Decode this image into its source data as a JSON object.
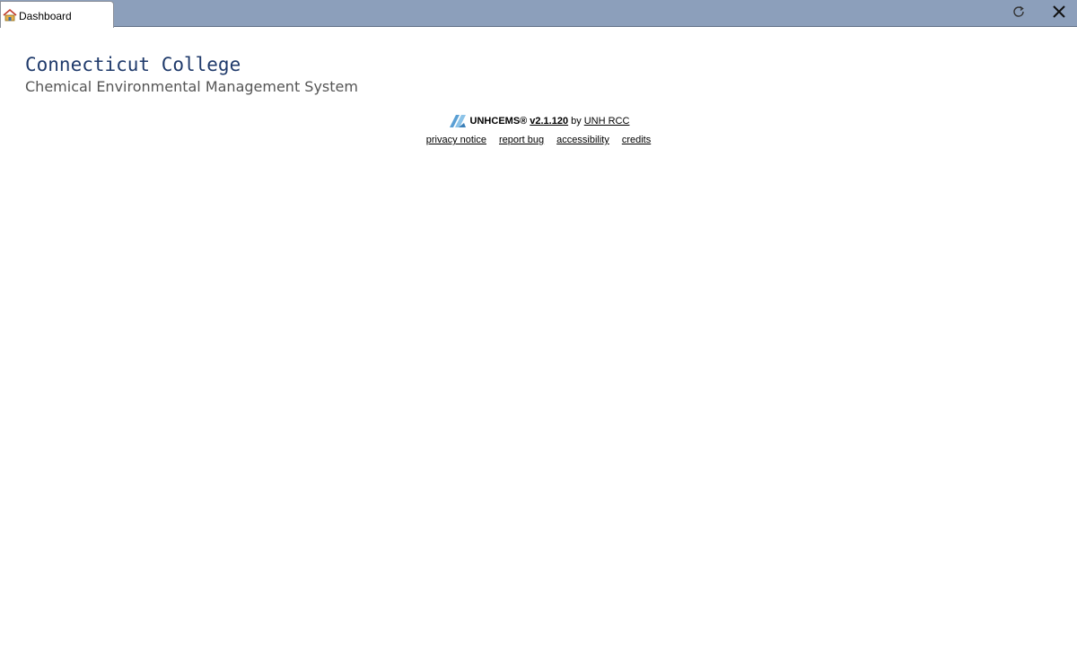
{
  "tabbar": {
    "tabs": [
      {
        "label": "Dashboard",
        "icon": "home-icon"
      }
    ],
    "refresh_icon": "refresh-icon",
    "close_icon": "close-icon",
    "bar_color": "#8c9fbb"
  },
  "header": {
    "organization": "Connecticut College",
    "system_name": "Chemical Environmental Management System"
  },
  "credits": {
    "product": "UNHCEMS®",
    "version": "v2.1.120",
    "by": "by",
    "vendor": "UNH RCC",
    "logo_icon": "unhcems-logo-icon"
  },
  "footer_links": [
    {
      "label": "privacy notice"
    },
    {
      "label": "report bug"
    },
    {
      "label": "accessibility"
    },
    {
      "label": "credits"
    }
  ]
}
